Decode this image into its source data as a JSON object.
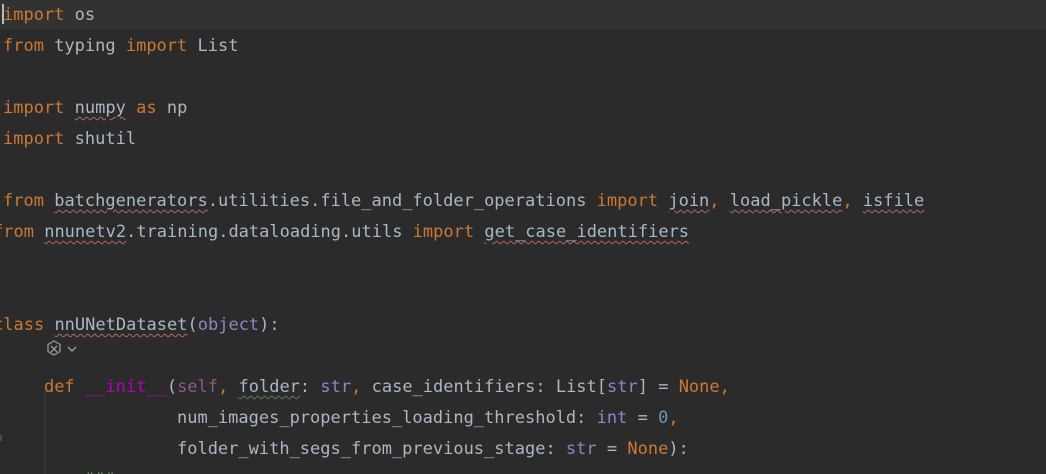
{
  "editor": {
    "language": "python",
    "colors": {
      "background": "#2b2b2b",
      "current_line": "#323232",
      "keyword": "#cc7832",
      "text": "#a9b7c6",
      "self": "#94558d",
      "builtin": "#8888c6",
      "magic_method": "#b200b2",
      "number": "#6897bb",
      "docstring": "#629755",
      "spell_check_underline": "#b8675e"
    },
    "lines": [
      {
        "tokens": [
          {
            "t": "import",
            "c": "kw"
          },
          {
            "t": " os",
            "c": "plain"
          }
        ]
      },
      {
        "tokens": [
          {
            "t": "from",
            "c": "kw"
          },
          {
            "t": " typing ",
            "c": "plain"
          },
          {
            "t": "import",
            "c": "kw"
          },
          {
            "t": " List",
            "c": "plain"
          }
        ]
      },
      {
        "tokens": []
      },
      {
        "tokens": [
          {
            "t": "import",
            "c": "kw"
          },
          {
            "t": " ",
            "c": "plain"
          },
          {
            "t": "numpy",
            "c": "plain",
            "u": 1
          },
          {
            "t": " ",
            "c": "plain"
          },
          {
            "t": "as",
            "c": "kw"
          },
          {
            "t": " np",
            "c": "plain"
          }
        ]
      },
      {
        "tokens": [
          {
            "t": "import",
            "c": "kw"
          },
          {
            "t": " shutil",
            "c": "plain"
          }
        ]
      },
      {
        "tokens": []
      },
      {
        "tokens": [
          {
            "t": "from",
            "c": "kw"
          },
          {
            "t": " ",
            "c": "plain"
          },
          {
            "t": "batchgenerators",
            "c": "plain",
            "u": 1
          },
          {
            "t": ".utilities.file_and_folder_operations ",
            "c": "plain"
          },
          {
            "t": "import",
            "c": "kw"
          },
          {
            "t": " ",
            "c": "plain"
          },
          {
            "t": "join",
            "c": "plain",
            "u": 1
          },
          {
            "t": ", ",
            "c": "kw"
          },
          {
            "t": "load_pickle",
            "c": "plain",
            "u": 1
          },
          {
            "t": ", ",
            "c": "kw"
          },
          {
            "t": "isfile",
            "c": "plain",
            "u": 1
          }
        ]
      },
      {
        "tokens": [
          {
            "t": "from",
            "c": "kw"
          },
          {
            "t": " ",
            "c": "plain"
          },
          {
            "t": "nnunetv2",
            "c": "plain",
            "u": 1
          },
          {
            "t": ".training.dataloading.utils ",
            "c": "plain"
          },
          {
            "t": "import",
            "c": "kw"
          },
          {
            "t": " ",
            "c": "plain"
          },
          {
            "t": "get_case_identifiers",
            "c": "plain",
            "u": 1
          }
        ]
      },
      {
        "tokens": []
      },
      {
        "tokens": []
      },
      {
        "tokens": [
          {
            "t": "class",
            "c": "kw"
          },
          {
            "t": " ",
            "c": "plain"
          },
          {
            "t": "nnUNetDataset",
            "c": "plain",
            "u": 1
          },
          {
            "t": "(",
            "c": "plain"
          },
          {
            "t": "object",
            "c": "builtin"
          },
          {
            "t": "):",
            "c": "plain"
          }
        ]
      },
      {
        "tokens": []
      },
      {
        "tokens": [
          {
            "t": "    ",
            "c": "plain"
          },
          {
            "t": "def",
            "c": "kw"
          },
          {
            "t": " ",
            "c": "plain"
          },
          {
            "t": "__init__",
            "c": "magic"
          },
          {
            "t": "(",
            "c": "plain"
          },
          {
            "t": "self",
            "c": "self"
          },
          {
            "t": ", ",
            "c": "kw"
          },
          {
            "t": "folder",
            "c": "plain",
            "u": 2
          },
          {
            "t": ": ",
            "c": "plain"
          },
          {
            "t": "str",
            "c": "builtin"
          },
          {
            "t": ", ",
            "c": "kw"
          },
          {
            "t": "case_identifiers: List[",
            "c": "plain"
          },
          {
            "t": "str",
            "c": "builtin"
          },
          {
            "t": "] = ",
            "c": "plain"
          },
          {
            "t": "None",
            "c": "kw"
          },
          {
            "t": ",",
            "c": "kw"
          }
        ]
      },
      {
        "tokens": [
          {
            "t": "                 num_images_properties_loading_threshold: ",
            "c": "plain"
          },
          {
            "t": "int",
            "c": "builtin"
          },
          {
            "t": " = ",
            "c": "plain"
          },
          {
            "t": "0",
            "c": "num"
          },
          {
            "t": ",",
            "c": "kw"
          }
        ]
      },
      {
        "tokens": [
          {
            "t": "                 folder_with_segs_from_previous_stage: ",
            "c": "plain"
          },
          {
            "t": "str",
            "c": "builtin"
          },
          {
            "t": " = ",
            "c": "plain"
          },
          {
            "t": "None",
            "c": "kw"
          },
          {
            "t": "):",
            "c": "plain"
          }
        ]
      },
      {
        "tokens": [
          {
            "t": "        ",
            "c": "plain"
          },
          {
            "t": "\"\"\"",
            "c": "str"
          }
        ]
      }
    ]
  },
  "gutter_hint": {
    "icon": "ai-assistant-icon",
    "chevron": "chevron-down-icon"
  }
}
